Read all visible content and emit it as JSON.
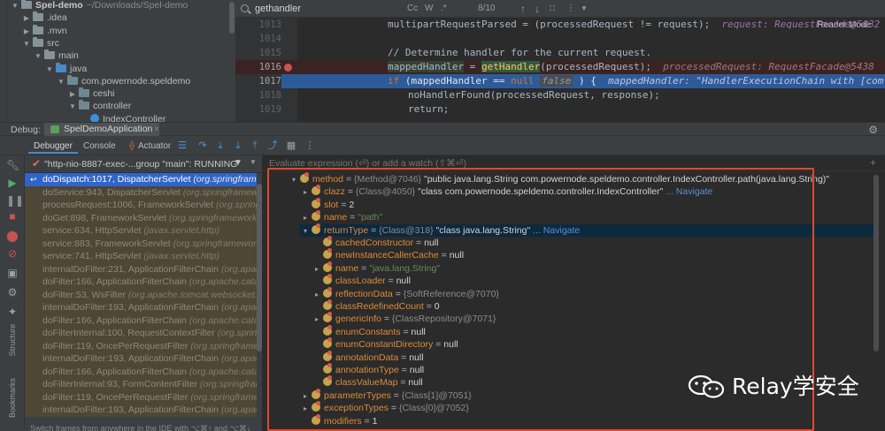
{
  "project_tree": {
    "items": [
      {
        "label": "Spel-demo",
        "path": "~/Downloads/Spel-demo",
        "depth": 0,
        "expanded": true,
        "kind": "module"
      },
      {
        "label": ".idea",
        "depth": 1,
        "expanded": false,
        "kind": "folder"
      },
      {
        "label": ".mvn",
        "depth": 1,
        "expanded": false,
        "kind": "folder"
      },
      {
        "label": "src",
        "depth": 1,
        "expanded": true,
        "kind": "folder"
      },
      {
        "label": "main",
        "depth": 2,
        "expanded": true,
        "kind": "folder"
      },
      {
        "label": "java",
        "depth": 3,
        "expanded": true,
        "kind": "source"
      },
      {
        "label": "com.powernode.speldemo",
        "depth": 4,
        "expanded": true,
        "kind": "package"
      },
      {
        "label": "ceshi",
        "depth": 5,
        "expanded": false,
        "kind": "package"
      },
      {
        "label": "controller",
        "depth": 5,
        "expanded": true,
        "kind": "package"
      },
      {
        "label": "IndexController",
        "depth": 6,
        "expanded": false,
        "kind": "class"
      }
    ]
  },
  "search": {
    "value": "gethandler",
    "match_case": "Cc",
    "words": "W",
    "regex": ".*",
    "count": "8/10",
    "up": "↑",
    "down": "↓",
    "select_all": "□",
    "more": "⋮",
    "filter": "▼"
  },
  "editor": {
    "reader_mode": "Reader Mode",
    "lines": [
      {
        "num": "1013",
        "state": "normal"
      },
      {
        "num": "1014",
        "state": "normal"
      },
      {
        "num": "1015",
        "state": "normal"
      },
      {
        "num": "1016",
        "state": "breakpoint"
      },
      {
        "num": "1017",
        "state": "current"
      },
      {
        "num": "1018",
        "state": "normal"
      },
      {
        "num": "1019",
        "state": "normal"
      }
    ],
    "code": {
      "l1013_a": "multipartRequestParsed = (processedRequest != request);",
      "l1013_hint": "request: RequestFacade@5432",
      "l1015_comment": "// Determine handler for the current request.",
      "l1016_var": "mappedHandler",
      "l1016_eq": " = ",
      "l1016_fn": "getHandler",
      "l1016_arg": "(processedRequest);",
      "l1016_hint": "processedRequest: RequestFacade@5438",
      "l1017_kw": "if",
      "l1017_a": " (mappedHandler == ",
      "l1017_null": "null",
      "l1017_box": "false",
      "l1017_b": " ) {",
      "l1017_hint": "mappedHandler: \"HandlerExecutionChain with [com.powernode.spe",
      "l1018": "noHandlerFound(processedRequest, response);",
      "l1019_kw": "return;"
    }
  },
  "debug": {
    "label": "Debug:",
    "tab": "SpelDemoApplication",
    "close": "×",
    "settings_icon": "⚙"
  },
  "toolbar": {
    "tabs": [
      "Debugger",
      "Console",
      "Actuator"
    ]
  },
  "side_labels": {
    "structure": "Structure",
    "bookmarks": "Bookmarks"
  },
  "frames": {
    "thread": "\"http-nio-8887-exec-...group \"main\": RUNNING",
    "items": [
      {
        "method": "doDispatch:1017, DispatcherServlet",
        "cls": "(org.springframework.web.servlet)",
        "selected": true
      },
      {
        "method": "doService:943, DispatcherServlet",
        "cls": "(org.springframework.web.servlet)"
      },
      {
        "method": "processRequest:1006, FrameworkServlet",
        "cls": "(org.springframework.web.servlet)"
      },
      {
        "method": "doGet:898, FrameworkServlet",
        "cls": "(org.springframework.web.servlet)"
      },
      {
        "method": "service:634, HttpServlet",
        "cls": "(javax.servlet.http)"
      },
      {
        "method": "service:883, FrameworkServlet",
        "cls": "(org.springframework.web.servlet)"
      },
      {
        "method": "service:741, HttpServlet",
        "cls": "(javax.servlet.http)"
      },
      {
        "method": "internalDoFilter:231, ApplicationFilterChain",
        "cls": "(org.apache.catalina.core)"
      },
      {
        "method": "doFilter:166, ApplicationFilterChain",
        "cls": "(org.apache.catalina.core)"
      },
      {
        "method": "doFilter:53, WsFilter",
        "cls": "(org.apache.tomcat.websocket.server)"
      },
      {
        "method": "internalDoFilter:193, ApplicationFilterChain",
        "cls": "(org.apache.catalina.core)"
      },
      {
        "method": "doFilter:166, ApplicationFilterChain",
        "cls": "(org.apache.catalina.core)"
      },
      {
        "method": "doFilterInternal:100, RequestContextFilter",
        "cls": "(org.springframework.web.filter)"
      },
      {
        "method": "doFilter:119, OncePerRequestFilter",
        "cls": "(org.springframework.web.filter)"
      },
      {
        "method": "internalDoFilter:193, ApplicationFilterChain",
        "cls": "(org.apache.catalina.core)"
      },
      {
        "method": "doFilter:166, ApplicationFilterChain",
        "cls": "(org.apache.catalina.core)"
      },
      {
        "method": "doFilterInternal:93, FormContentFilter",
        "cls": "(org.springframework.web.filter)"
      },
      {
        "method": "doFilter:119, OncePerRequestFilter",
        "cls": "(org.springframework.web.filter)"
      },
      {
        "method": "internalDoFilter:193, ApplicationFilterChain",
        "cls": "(org.apache.catalina.core)"
      }
    ],
    "hint": "Switch frames from anywhere in the IDE with ⌥⌘↑ and ⌥⌘↓"
  },
  "variables": {
    "eval_placeholder": "Evaluate expression (⏎) or add a watch (⇧⌘⏎)",
    "add": "+",
    "rows": [
      {
        "indent": 0,
        "toggle": "▾",
        "name": "method",
        "type": "{Method@7046}",
        "value": "\"public java.lang.String com.powernode.speldemo.controller.IndexController.path(java.lang.String)\"",
        "vclass": "vq"
      },
      {
        "indent": 1,
        "toggle": "▸",
        "name": "clazz",
        "type": "{Class@4050}",
        "value": "\"class com.powernode.speldemo.controller.IndexController\"",
        "vclass": "vq",
        "nav": "... Navigate"
      },
      {
        "indent": 1,
        "toggle": "",
        "name": "slot",
        "type": "",
        "value": "2",
        "vclass": "vq"
      },
      {
        "indent": 1,
        "toggle": "▸",
        "name": "name",
        "type": "",
        "value": "\"path\"",
        "vclass": "vs"
      },
      {
        "indent": 1,
        "toggle": "▾",
        "name": "returnType",
        "type": "{Class@318}",
        "value": "\"class java.lang.String\"",
        "vclass": "vq",
        "nav": "... Navigate",
        "selected": true
      },
      {
        "indent": 2,
        "toggle": "",
        "name": "cachedConstructor",
        "type": "",
        "value": "null",
        "vclass": "vq"
      },
      {
        "indent": 2,
        "toggle": "",
        "name": "newInstanceCallerCache",
        "type": "",
        "value": "null",
        "vclass": "vq"
      },
      {
        "indent": 2,
        "toggle": "▸",
        "name": "name",
        "type": "",
        "value": "\"java.lang.String\"",
        "vclass": "vs"
      },
      {
        "indent": 2,
        "toggle": "",
        "name": "classLoader",
        "type": "",
        "value": "null",
        "vclass": "vq"
      },
      {
        "indent": 2,
        "toggle": "▸",
        "name": "reflectionData",
        "type": "{SoftReference@7070}",
        "value": "",
        "vclass": "vq"
      },
      {
        "indent": 2,
        "toggle": "",
        "name": "classRedefinedCount",
        "type": "",
        "value": "0",
        "vclass": "vq"
      },
      {
        "indent": 2,
        "toggle": "▸",
        "name": "genericInfo",
        "type": "{ClassRepository@7071}",
        "value": "",
        "vclass": "vq"
      },
      {
        "indent": 2,
        "toggle": "",
        "name": "enumConstants",
        "type": "",
        "value": "null",
        "vclass": "vq"
      },
      {
        "indent": 2,
        "toggle": "",
        "name": "enumConstantDirectory",
        "type": "",
        "value": "null",
        "vclass": "vq"
      },
      {
        "indent": 2,
        "toggle": "",
        "name": "annotationData",
        "type": "",
        "value": "null",
        "vclass": "vq"
      },
      {
        "indent": 2,
        "toggle": "",
        "name": "annotationType",
        "type": "",
        "value": "null",
        "vclass": "vq"
      },
      {
        "indent": 2,
        "toggle": "",
        "name": "classValueMap",
        "type": "",
        "value": "null",
        "vclass": "vq"
      },
      {
        "indent": 1,
        "toggle": "▸",
        "name": "parameterTypes",
        "type": "{Class[1]@7051}",
        "value": "",
        "vclass": "vq"
      },
      {
        "indent": 1,
        "toggle": "▸",
        "name": "exceptionTypes",
        "type": "{Class[0]@7052}",
        "value": "",
        "vclass": "vq"
      },
      {
        "indent": 1,
        "toggle": "",
        "name": "modifiers",
        "type": "",
        "value": "1",
        "vclass": "vq"
      }
    ]
  },
  "watermark": {
    "text": "Relay学安全"
  },
  "colors": {
    "accent": "#2f65ca",
    "highlight_box": "#e24830",
    "breakpoint": "#c75450"
  }
}
